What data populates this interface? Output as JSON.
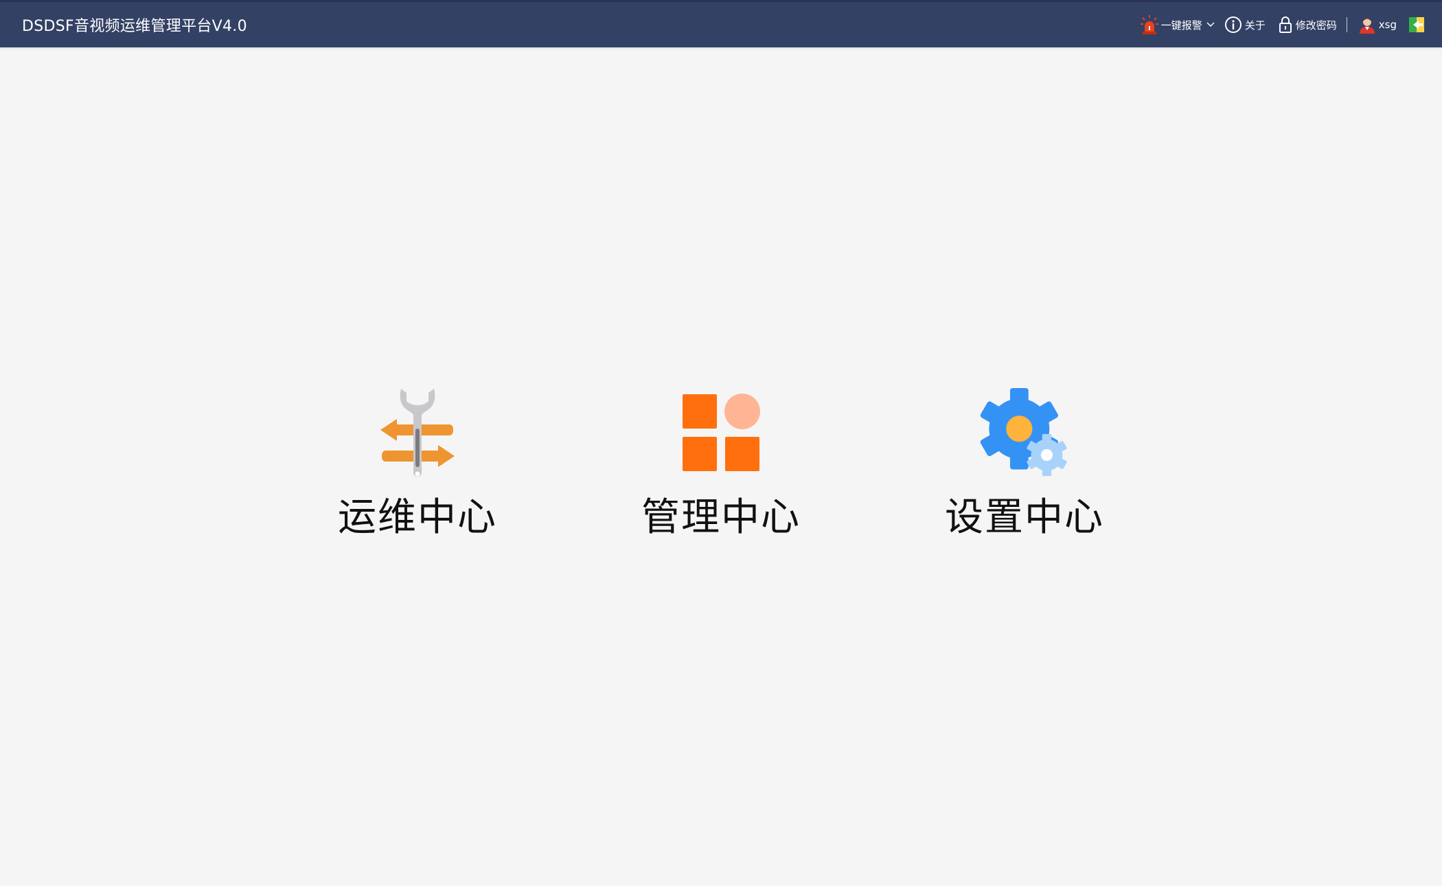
{
  "header": {
    "title": "DSDSF音视频运维管理平台V4.0",
    "alarm_label": "一键报警",
    "about_label": "关于",
    "change_password_label": "修改密码",
    "username": "xsg",
    "colors": {
      "background": "#334165",
      "alarm_icon": "#e8431e",
      "logout_icon": "#33b04a"
    }
  },
  "centers": [
    {
      "label": "运维中心",
      "icon": "wrench-arrows-icon",
      "color": "#ee9531"
    },
    {
      "label": "管理中心",
      "icon": "app-grid-icon",
      "color": "#ff6f0e"
    },
    {
      "label": "设置中心",
      "icon": "settings-gear-icon",
      "color": "#3592f5"
    }
  ]
}
